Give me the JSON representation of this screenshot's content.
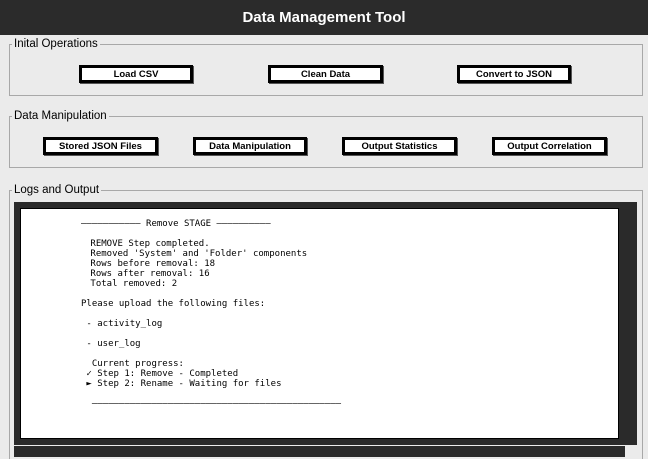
{
  "window": {
    "title": "Data Management Tool"
  },
  "initial_operations": {
    "legend": "Inital Operations",
    "buttons": [
      "Load CSV",
      "Clean Data",
      "Convert to JSON"
    ]
  },
  "data_manipulation": {
    "legend": "Data Manipulation",
    "buttons": [
      "Stored JSON Files",
      "Data Manipulation",
      "Output Statistics",
      "Output Correlation"
    ]
  },
  "logs": {
    "legend": "Logs and Output",
    "lines": [
      "——————————— Remove STAGE ——————————",
      "",
      " REMOVE Step completed.",
      " Removed 'System' and 'Folder' components",
      " Rows before removal: 18",
      " Rows after removal: 16",
      " Total removed: 2",
      "",
      "Please upload the following files:",
      "",
      " - activity_log",
      "",
      " - user_log",
      "",
      "  Current progress:",
      " ✓ Step 1: Remove - Completed",
      " ► Step 2: Rename - Waiting for files",
      "",
      "  ——————————————————————————————————————————————"
    ]
  }
}
